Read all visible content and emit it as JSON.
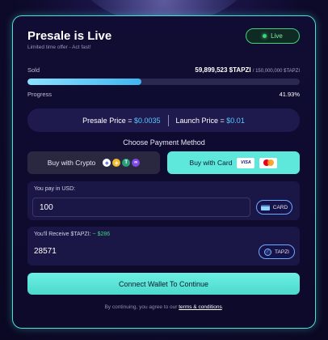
{
  "header": {
    "title": "Presale is Live",
    "subtitle": "Limited time offer - Act fast!",
    "live_label": "Live"
  },
  "sale": {
    "sold_label": "Sold",
    "sold_amount": "59,899,523 $TAPZI",
    "sold_total": "/ 150,000,000 $TAPZI",
    "progress_label": "Progress",
    "progress_pct": "41.93%",
    "progress_fraction": 0.4193
  },
  "prices": {
    "presale_label": "Presale Price = ",
    "presale_value": "$0.0035",
    "launch_label": "Launch Price = ",
    "launch_value": "$0.01"
  },
  "payment": {
    "heading": "Choose Payment Method",
    "crypto_label": "Buy with Crypto",
    "card_label": "Buy with Card",
    "visa_text": "VISA"
  },
  "pay_field": {
    "label": "You pay in USD:",
    "value": "100",
    "chip_label": "CARD"
  },
  "receive_field": {
    "label": "You'll Receive $TAPZI:",
    "usd_equiv": "~ $286",
    "value": "28571",
    "chip_label": "TAPZI"
  },
  "cta": {
    "connect_label": "Connect Wallet To Continue"
  },
  "footer": {
    "terms_prefix": "By continuing, you agree to our ",
    "terms_link": "terms & conditions",
    "terms_suffix": "."
  },
  "colors": {
    "accent_teal": "#5ee8dc",
    "accent_blue": "#5cc8ff",
    "live_green": "#3fd17c",
    "card_bg": "#100c33"
  }
}
